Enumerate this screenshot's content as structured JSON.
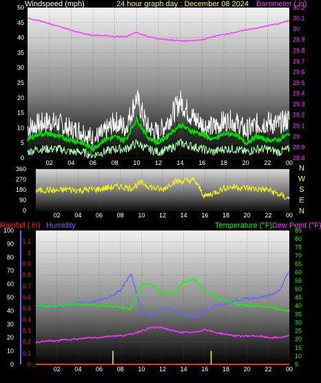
{
  "header": {
    "left_title": "Windspeed (mph)",
    "center_title": "24 hour graph day : December 08 2024",
    "right_title": "Barometer (.in)"
  },
  "colors": {
    "windspeed": "#ffffff",
    "wind_avg": "#00dd00",
    "wind_light": "#aaffaa",
    "barometer": "#ff33ff",
    "direction": "#ffff00",
    "rainfall": "#ff2020",
    "humidity": "#6666ff",
    "temperature": "#00ff00",
    "dew_point": "#ff33ff",
    "rain_bar": "#ffff00"
  },
  "chart_data": [
    {
      "type": "line",
      "panel": "wind-barometer",
      "x_tick_labels": [
        "02",
        "04",
        "06",
        "08",
        "10",
        "12",
        "14",
        "16",
        "18",
        "20",
        "22",
        "00"
      ],
      "hours": [
        0,
        1,
        2,
        3,
        4,
        5,
        6,
        7,
        8,
        9,
        10,
        11,
        12,
        13,
        14,
        15,
        16,
        17,
        18,
        19,
        20,
        21,
        22,
        23,
        24
      ],
      "y_left": {
        "label": "Windspeed (mph)",
        "ticks": [
          0,
          5,
          10,
          15,
          20,
          25,
          30,
          35,
          40,
          45,
          50
        ],
        "ylim": [
          0,
          50
        ]
      },
      "y_right": {
        "label": "Barometer (.in)",
        "ticks": [
          "28.8",
          "28.9",
          "29",
          "29.1",
          "29.2",
          "29.3",
          "29.4",
          "29.5",
          "29.6",
          "29.7",
          "29.8",
          "29.9",
          "30",
          "30.1",
          "30.2"
        ],
        "ylim": [
          28.8,
          30.2
        ]
      },
      "series": [
        {
          "name": "Windspeed (mph)",
          "axis": "left",
          "values": [
            10,
            11,
            12,
            11,
            9,
            9,
            6,
            8,
            12,
            10,
            20,
            10,
            8,
            13,
            19,
            14,
            11,
            10,
            12,
            12,
            9,
            11,
            12,
            11,
            13
          ]
        },
        {
          "name": "",
          "axis": "left",
          "values": [
            6,
            8,
            8,
            7,
            6,
            5,
            3,
            6,
            7,
            6,
            13,
            7,
            5,
            8,
            11,
            9,
            8,
            6,
            8,
            8,
            5,
            7,
            6,
            6,
            8
          ]
        },
        {
          "name": "",
          "axis": "left",
          "values": [
            2,
            3,
            3,
            3,
            2,
            2,
            1,
            2,
            3,
            3,
            5,
            3,
            2,
            3,
            5,
            4,
            3,
            2,
            3,
            3,
            2,
            3,
            3,
            2,
            3
          ]
        },
        {
          "name": "Barometer (.in)",
          "axis": "right",
          "values": [
            30.1,
            30.08,
            30.05,
            30.02,
            29.99,
            29.96,
            29.94,
            29.94,
            29.93,
            29.93,
            29.97,
            29.93,
            29.91,
            29.9,
            29.89,
            29.89,
            29.9,
            29.93,
            29.95,
            29.97,
            29.99,
            30.01,
            30.03,
            30.05,
            30.08
          ]
        }
      ]
    },
    {
      "type": "line",
      "panel": "wind-direction",
      "x_tick_labels": [
        "02",
        "04",
        "06",
        "08",
        "10",
        "12",
        "14",
        "16",
        "18",
        "20",
        "22",
        "00"
      ],
      "hours": [
        0,
        1,
        2,
        3,
        4,
        5,
        6,
        7,
        8,
        9,
        10,
        11,
        12,
        13,
        14,
        15,
        16,
        17,
        18,
        19,
        20,
        21,
        22,
        23,
        24
      ],
      "y_left": {
        "ticks": [
          0,
          90,
          180,
          270,
          360
        ],
        "ylim": [
          0,
          360
        ]
      },
      "y_right_labels": [
        "N",
        "W",
        "S",
        "E",
        "N"
      ],
      "series": [
        {
          "name": "",
          "values": [
            170,
            180,
            170,
            185,
            175,
            180,
            185,
            200,
            210,
            195,
            240,
            200,
            180,
            250,
            255,
            265,
            120,
            160,
            200,
            205,
            195,
            185,
            180,
            140,
            100
          ]
        }
      ]
    },
    {
      "type": "line",
      "panel": "temperature-humidity",
      "x_tick_labels": [
        "02",
        "04",
        "06",
        "08",
        "10",
        "12",
        "14",
        "16",
        "18",
        "20",
        "22",
        "00"
      ],
      "hours": [
        0,
        1,
        2,
        3,
        4,
        5,
        6,
        7,
        8,
        9,
        10,
        11,
        12,
        13,
        14,
        15,
        16,
        17,
        18,
        19,
        20,
        21,
        22,
        23,
        24
      ],
      "y_left_outer": {
        "label": "Humidity",
        "ticks": [
          0,
          10,
          20,
          30,
          40,
          50,
          60,
          70,
          80,
          90,
          100
        ],
        "ylim": [
          0,
          100
        ]
      },
      "y_left_inner": {
        "label": "Rainfall (.in)",
        "ticks": [
          "0",
          "0.1",
          "0.2",
          "0.3",
          "0.4",
          "0.5",
          "0.6",
          "0.7",
          "0.8",
          "0.9",
          "1",
          "1.1"
        ],
        "ylim": [
          0,
          1.2
        ]
      },
      "y_right": {
        "label": "Temperature (°F)",
        "ticks": [
          5,
          10,
          15,
          20,
          25,
          30,
          35,
          40,
          45,
          50,
          55,
          60,
          65,
          70,
          75,
          80,
          85
        ],
        "ylim": [
          5,
          85
        ]
      },
      "extra_label": "Dew Point (°F)",
      "series": [
        {
          "name": "Temperature (°F)",
          "axis": "right",
          "values": [
            40,
            40,
            40,
            41,
            41,
            41,
            40,
            40,
            39,
            38,
            53,
            53,
            47,
            48,
            54,
            56,
            49,
            45,
            43,
            41,
            40,
            40,
            39,
            38,
            37
          ]
        },
        {
          "name": "Humidity",
          "axis": "left_outer",
          "values": [
            43,
            44,
            43,
            44,
            46,
            46,
            48,
            50,
            55,
            68,
            40,
            36,
            42,
            41,
            38,
            35,
            40,
            44,
            45,
            48,
            49,
            50,
            51,
            54,
            70
          ]
        },
        {
          "name": "Dew Point (°F)",
          "axis": "right",
          "values": [
            18,
            19,
            19,
            20,
            20,
            21,
            21,
            22,
            22,
            23,
            25,
            27,
            27,
            25,
            24,
            24,
            26,
            24,
            23,
            22,
            22,
            22,
            21,
            21,
            22
          ]
        },
        {
          "name": "Rainfall (.in)",
          "axis": "left_inner",
          "values": [
            0,
            0,
            0,
            0,
            0,
            0,
            0,
            0,
            0,
            0,
            0,
            0,
            0,
            0,
            0,
            0,
            0,
            0,
            0,
            0,
            0,
            0,
            0,
            0,
            0
          ]
        }
      ],
      "rain_events_hours": [
        7.3,
        16.6
      ],
      "rain_event_values": [
        0.06,
        0.06
      ]
    }
  ]
}
